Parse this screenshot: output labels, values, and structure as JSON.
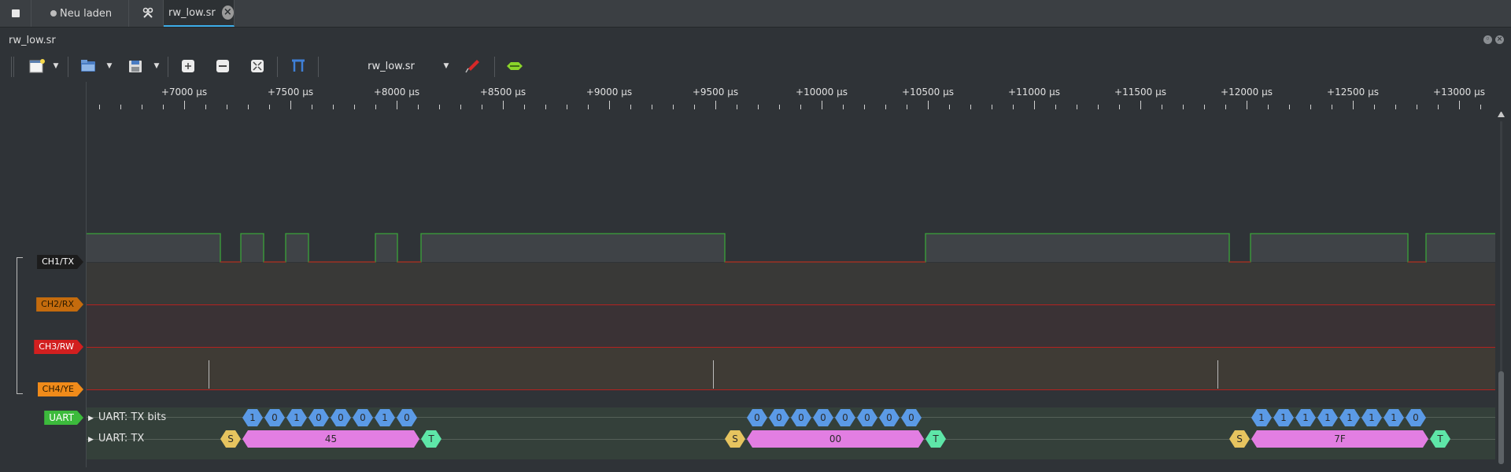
{
  "tabs": {
    "new_label": "Neu laden",
    "file_label": "rw_low.sr",
    "close_glyph": "×"
  },
  "window": {
    "title": "rw_low.sr"
  },
  "toolbar": {
    "device_select": "rw_low.sr",
    "icons": [
      "new-session-icon",
      "open-file-icon",
      "save-icon",
      "zoom-fit-icon",
      "zoom-one-icon",
      "zoom-best-icon",
      "cursor-icon",
      "probe-icon",
      "decoder-icon"
    ]
  },
  "ruler": {
    "unit": "µs",
    "labels": [
      "+7000 µs",
      "+7500 µs",
      "+8000 µs",
      "+8500 µs",
      "+9000 µs",
      "+9500 µs",
      "+10000 µs",
      "+10500 µs",
      "+11000 µs",
      "+11500 µs",
      "+12000 µs",
      "+12500 µs",
      "+13000 µs"
    ]
  },
  "channels": [
    {
      "name": "CH1/TX",
      "color": "#1c1c1c",
      "text": "#ffffff"
    },
    {
      "name": "CH2/RX",
      "color": "#c46b0d",
      "text": "#2a1a00"
    },
    {
      "name": "CH3/RW",
      "color": "#d21f1f",
      "text": "#ffffff"
    },
    {
      "name": "CH4/YE",
      "color": "#f08b1a",
      "text": "#2a1a00"
    }
  ],
  "decoder": {
    "name": "UART",
    "color": "#3cba3c",
    "rows": [
      "UART: TX bits",
      "UART: TX"
    ],
    "frames": [
      {
        "bits": [
          "1",
          "0",
          "1",
          "0",
          "0",
          "0",
          "1",
          "0"
        ],
        "start": "S",
        "value": "45",
        "stop": "T"
      },
      {
        "bits": [
          "0",
          "0",
          "0",
          "0",
          "0",
          "0",
          "0",
          "0"
        ],
        "start": "S",
        "value": "00",
        "stop": "T"
      },
      {
        "bits": [
          "1",
          "1",
          "1",
          "1",
          "1",
          "1",
          "1",
          "0"
        ],
        "start": "S",
        "value": "7F",
        "stop": "T"
      }
    ]
  },
  "colors": {
    "accent": "#3daee9",
    "trace_high": "#3aa33a",
    "trace_low": "#b3211f",
    "bit_fill": "#5b9ae6",
    "data_fill": "#e27ee2",
    "start_fill": "#e6c45f",
    "stop_fill": "#5ee6a8"
  }
}
